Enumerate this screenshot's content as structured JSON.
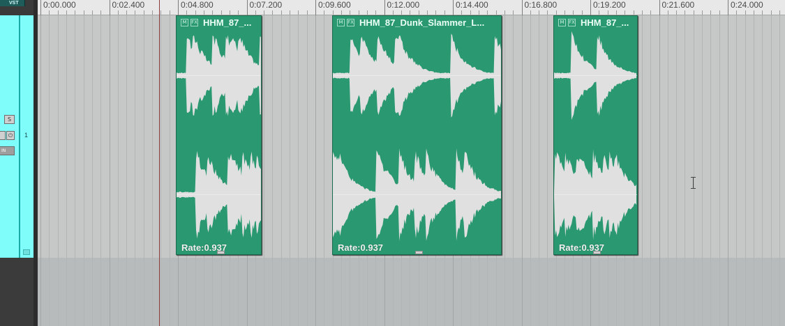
{
  "track_panel": {
    "tab_label": "VST",
    "solo_label": "S",
    "input_label": "IN",
    "track_number": "1"
  },
  "ruler": {
    "labels": [
      "0:00.000",
      "0:02.400",
      "0:04.800",
      "0:07.200",
      "0:09.600",
      "0:12.000",
      "0:14.400",
      "0:16.800",
      "0:19.200",
      "0:21.600",
      "0:24.000"
    ]
  },
  "items": [
    {
      "title": "HHM_87_...",
      "rate": "Rate:0.937"
    },
    {
      "title": "HHM_87_Dunk_Slammer_L...",
      "rate": "Rate:0.937"
    },
    {
      "title": "HHM_87_...",
      "rate": "Rate:0.937"
    }
  ],
  "colors": {
    "track": "#7ffdfb",
    "item": "#2a9870",
    "waveform": "#e0e0e0",
    "edit_cursor": "#8b3b3b"
  },
  "icons": [
    "mute-icon",
    "fx-icon",
    "power-icon",
    "folder-icon",
    "ibeam-cursor-icon"
  ]
}
